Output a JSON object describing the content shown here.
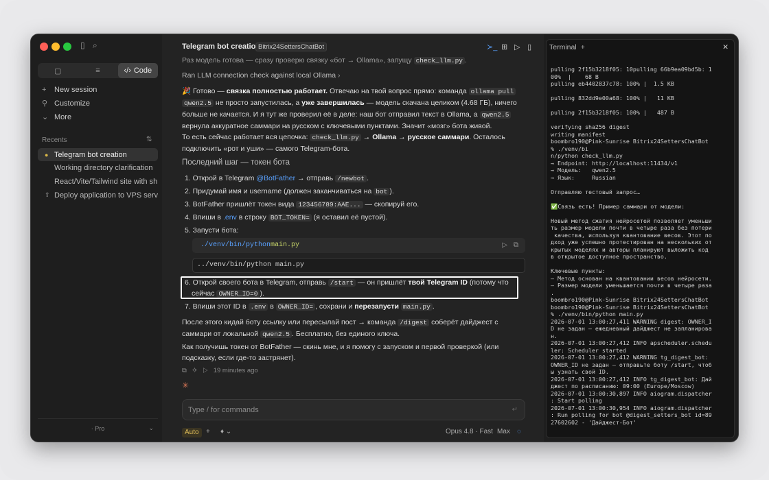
{
  "window": {
    "app": "Claude"
  },
  "sidebar": {
    "tabs": [
      {
        "label": ""
      },
      {
        "label": ""
      },
      {
        "label": "Code"
      }
    ],
    "nav": [
      {
        "icon": "plus-icon",
        "label": "New session"
      },
      {
        "icon": "customize-icon",
        "label": "Customize"
      },
      {
        "icon": "chevron-down-icon",
        "label": "More"
      }
    ],
    "recents_label": "Recents",
    "recents": [
      {
        "label": "Telegram bot creation",
        "selected": true
      },
      {
        "label": "Working directory clarification",
        "selected": false
      },
      {
        "label": "React/Vite/Tailwind site with sh",
        "selected": false
      },
      {
        "label": "Deploy application to VPS serve",
        "selected": false
      }
    ],
    "plan": "· Pro"
  },
  "header": {
    "title": "Telegram bot creation",
    "badge": "Bitrix24SettersChatBot"
  },
  "chat": {
    "top_line_text": "Раз модель готова — сразу проверю связку «бот → Ollama», запущу",
    "top_line_code": "check_llm.py",
    "tool_call": "Ran LLM connection check against local Ollama",
    "p1": {
      "a": "🎉 Готово — ",
      "b": "связка полностью работает.",
      "c": " Отвечаю на твой вопрос прямо: команда ",
      "code1": "ollama pull",
      "code2": "qwen2.5",
      "d": " не просто запустилась, а ",
      "e": "уже завершилась",
      "f": " — модель скачана целиком (4.68 ГБ), ничего",
      "g": "больше не качается. И я тут же проверил её в деле: наш бот отправил текст в Ollama, а ",
      "code3": "qwen2.5",
      "h": "вернула аккуратное саммари на русском с ключевыми пунктами. Значит «мозг» бота живой."
    },
    "p2": {
      "a": "То есть сейчас работает вся цепочка: ",
      "code": "check_llm.py",
      "b": " → Ollama → русское саммари",
      "c": ". Осталось",
      "d": "подключить «рот и уши» — самого Telegram-бота."
    },
    "heading": "Последний шаг — токен бота",
    "steps": {
      "s1a": "1. Открой в Telegram ",
      "s1link": "@BotFather",
      "s1b": " → отправь ",
      "s1code": "/newbot",
      "s1c": ".",
      "s2a": "2. Придумай имя и username (должен заканчиваться на ",
      "s2code": "bot",
      "s2b": ").",
      "s3a": "3. BotFather пришлёт токен вида ",
      "s3code": "123456789:AAE...",
      "s3b": " — скопируй его.",
      "s4a": "4. Впиши в ",
      "s4link": ".env",
      "s4b": " в строку ",
      "s4code": "BOT_TOKEN=",
      "s4c": " (я оставил её пустой).",
      "s5": "5. Запусти бота:",
      "code_path": "./venv/bin/python",
      "code_file": " main.py",
      "code2": "../venv/bin/python main.py",
      "s6a": "6. Открой своего бота в Telegram, отправь ",
      "s6code": "/start",
      "s6b": " — он пришлёт ",
      "s6bold": "твой Telegram ID",
      "s6c": " (потому что",
      "s6d": "сейчас ",
      "s6code2": "OWNER_ID=0",
      "s6e": ").",
      "s7a": "7. Впиши этот ID в ",
      "s7code": ".env",
      "s7b": " в ",
      "s7code2": "OWNER_ID=",
      "s7c": ", сохрани и ",
      "s7bold": "перезапусти",
      "s7code3": "main.py",
      "s7d": "."
    },
    "p3": {
      "a": "После этого кидай боту ссылку или пересылай пост → команда ",
      "code": "/digest",
      "b": " соберёт дайджест с",
      "c": "саммари от локальной ",
      "code2": "qwen2.5",
      "d": ". Бесплатно, без единого ключа."
    },
    "p4": {
      "a": "Как получишь токен от BotFather — скинь мне, и я помогу с запуском и первой проверкой (или",
      "b": "подсказку, если где-то застрянет)."
    },
    "time": "19 minutes ago"
  },
  "composer": {
    "placeholder": "Type / for commands"
  },
  "footer": {
    "mode": "Auto",
    "model": "Opus 4.8 · Fast",
    "effort": "Max"
  },
  "terminal": {
    "title": "Terminal",
    "lines": [
      "pulling 2f15b3218f05: 10pulling 66b9ea09bd5b: 1",
      "00%  |    68 B",
      "pulling eb4402837c78: 100% |  1.5 KB",
      "",
      "pulling 832dd9e00a68: 100% |   11 KB",
      "",
      "pulling 2f15b3218f05: 100% |   487 B",
      "",
      "verifying sha256 digest",
      "writing manifest",
      "boombro190@Pink-Sunrise Bitrix24SettersChatBot",
      "% ./venv/bi",
      "n/python check_llm.py",
      "→ Endpoint: http://localhost:11434/v1",
      "→ Модель:   qwen2.5",
      "→ Язык:     Russian",
      "",
      "Отправляю тестовый запрос…",
      "",
      "✅Связь есть! Пример саммари от модели:",
      "",
      "Новый метод сжатия нейросетей позволяет уменьши",
      "ть размер модели почти в четыре раза без потери",
      " качества, используя квантование весов. Этот по",
      "дход уже успешно протестирован на нескольких от",
      "крытых моделях и авторы планируют выложить код",
      "в открытое доступное пространство.",
      "",
      "Ключевые пункты:",
      "– Метод основан на квантовании весов нейросети.",
      "– Размер модели уменьшается почти в четыре раза",
      ".",
      "boombro190@Pink-Sunrise Bitrix24SettersChatBot",
      "boombro190@Pink-Sunrise Bitrix24SettersChatBot",
      "% ./venv/bin/python main.py",
      "2026-07-01 13:00:27,411 WARNING digest: OWNER_I",
      "D не задан – ежедневный дайджест не запланирова",
      "н.",
      "2026-07-01 13:00:27,412 INFO apscheduler.schedu",
      "ler: Scheduler started",
      "2026-07-01 13:00:27,412 WARNING tg_digest_bot:",
      "OWNER_ID не задан – отправьте боту /start, чтоб",
      "ы узнать свой ID.",
      "2026-07-01 13:00:27,412 INFO tg_digest_bot: Дай",
      "джест по расписанию: 09:00 (Europe/Moscow)",
      "2026-07-01 13:00:30,897 INFO aiogram.dispatcher",
      ": Start polling",
      "2026-07-01 13:00:30,954 INFO aiogram.dispatcher",
      ": Run polling for bot @digest_setters_bot id=89",
      "27602602 - 'Дайджест-Бот'"
    ]
  }
}
